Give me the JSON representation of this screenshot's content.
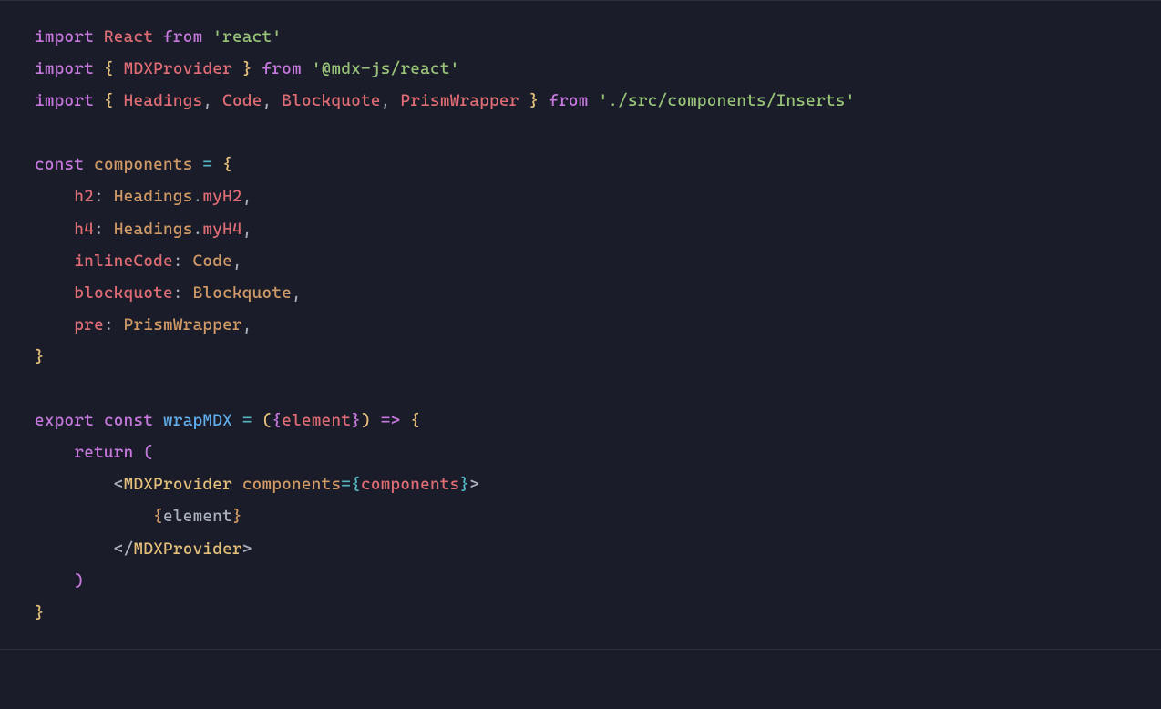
{
  "code": {
    "l1": {
      "import": "import",
      "ident": "React",
      "from": "from",
      "str": "'react'"
    },
    "l2": {
      "import": "import",
      "lb": "{",
      "ident": "MDXProvider",
      "rb": "}",
      "from": "from",
      "str": "'@mdx-js/react'"
    },
    "l3": {
      "import": "import",
      "lb": "{",
      "i1": "Headings",
      "i2": "Code",
      "i3": "Blockquote",
      "i4": "PrismWrapper",
      "rb": "}",
      "from": "from",
      "str": "'./src/components/Inserts'"
    },
    "l5": {
      "const": "const",
      "name": "components",
      "eq": "=",
      "lb": "{"
    },
    "l6": {
      "key": "h2",
      "colon": ":",
      "obj": "Headings",
      "dot": ".",
      "prop": "myH2",
      "comma": ","
    },
    "l7": {
      "key": "h4",
      "colon": ":",
      "obj": "Headings",
      "dot": ".",
      "prop": "myH4",
      "comma": ","
    },
    "l8": {
      "key": "inlineCode",
      "colon": ":",
      "val": "Code",
      "comma": ","
    },
    "l9": {
      "key": "blockquote",
      "colon": ":",
      "val": "Blockquote",
      "comma": ","
    },
    "l10": {
      "key": "pre",
      "colon": ":",
      "val": "PrismWrapper",
      "comma": ","
    },
    "l11": {
      "rb": "}"
    },
    "l13": {
      "export": "export",
      "const": "const",
      "name": "wrapMDX",
      "eq": "=",
      "lp": "(",
      "lb": "{",
      "param": "element",
      "rb": "}",
      "rp": ")",
      "arrow": "=>",
      "ob": "{"
    },
    "l14": {
      "return": "return",
      "lp": "("
    },
    "l15": {
      "lt": "<",
      "comp": "MDXProvider",
      "attr": "components",
      "eq": "=",
      "lb": "{",
      "val": "components",
      "rb": "}",
      "gt": ">"
    },
    "l16": {
      "lb": "{",
      "val": "element",
      "rb": "}"
    },
    "l17": {
      "lt": "<",
      "slash": "/",
      "comp": "MDXProvider",
      "gt": ">"
    },
    "l18": {
      "rp": ")"
    },
    "l19": {
      "rb": "}"
    }
  }
}
